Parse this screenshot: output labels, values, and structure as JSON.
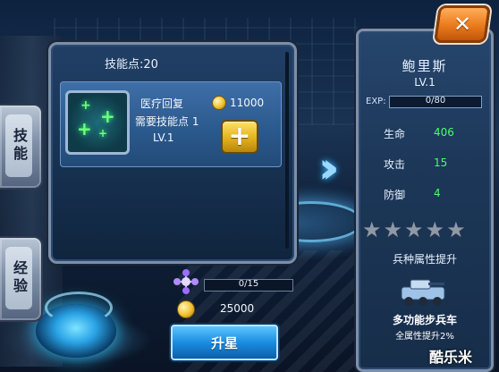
{
  "tabs": {
    "skill": "技能",
    "experience": "经验"
  },
  "skill_panel": {
    "points_label": "技能点:20",
    "skill": {
      "name": "医疗回复",
      "cost": "11000",
      "requirement": "需要技能点 1",
      "level": "LV.1",
      "icon": "medical-cross-icon"
    },
    "plus_label": "+"
  },
  "hero": {
    "name": "鲍里斯",
    "level": "LV.1",
    "exp_label": "EXP:",
    "exp_value": "0/80",
    "exp_progress": 0,
    "stats": [
      {
        "label": "生命",
        "value": "406"
      },
      {
        "label": "攻击",
        "value": "15"
      },
      {
        "label": "防御",
        "value": "4"
      }
    ],
    "stars_total": 5,
    "stars_filled": 0,
    "section_title": "兵种属性提升",
    "unit_name": "多功能步兵车",
    "unit_bonus": "全属性提升2%"
  },
  "upgrade": {
    "progress_text": "0/15",
    "progress": 0,
    "cost": "25000",
    "button_label": "升星"
  },
  "close_label": "✕",
  "watermark": "酷乐米",
  "colors": {
    "accent_blue": "#1a8de0",
    "stat_green": "#49ff6b",
    "close_orange": "#ea7a1c",
    "plus_gold": "#e2b21b"
  }
}
